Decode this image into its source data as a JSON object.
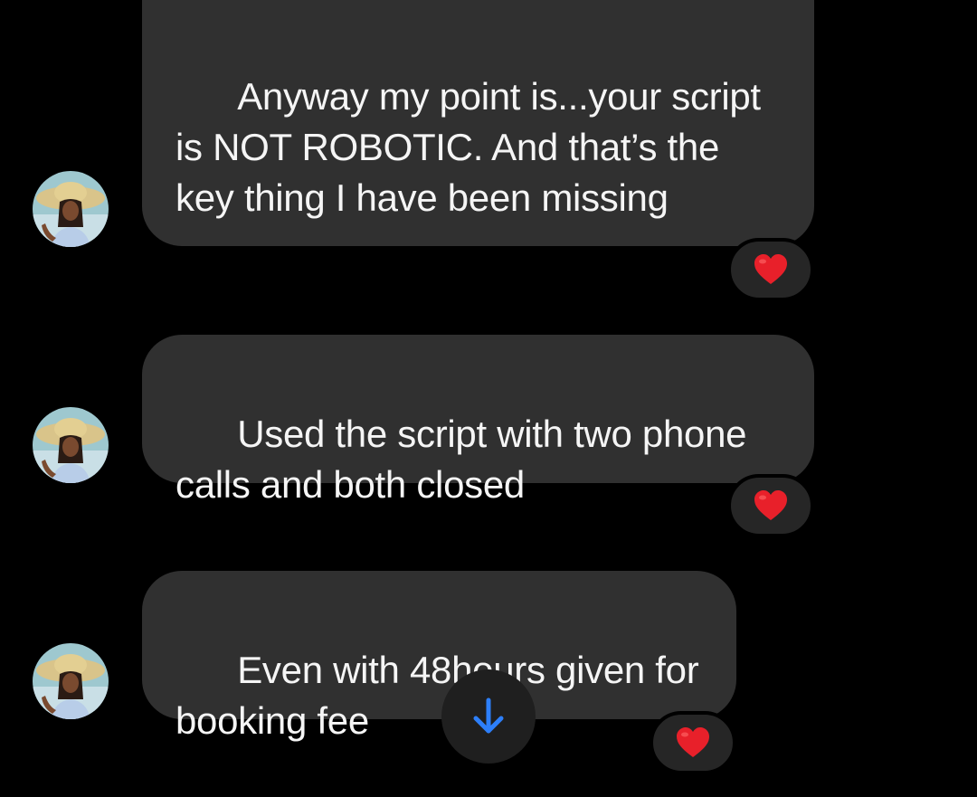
{
  "messages": [
    {
      "text": "Anyway my point is...your script is NOT ROBOTIC. And that’s the key thing I have been missing",
      "reaction": "heart"
    },
    {
      "text": "Used the script with two phone calls and both closed",
      "reaction": "heart"
    },
    {
      "text": "Even with 48hours given for booking fee",
      "reaction": "heart"
    }
  ],
  "icons": {
    "avatar": "profile-photo-icon",
    "reaction": "red-heart-icon",
    "scroll": "arrow-down-icon"
  },
  "colors": {
    "background": "#000000",
    "bubble": "#303030",
    "text": "#f5f5f5",
    "reaction_pill": "#262626",
    "heart": "#e8202a",
    "scroll_arrow": "#2d7ff9"
  }
}
